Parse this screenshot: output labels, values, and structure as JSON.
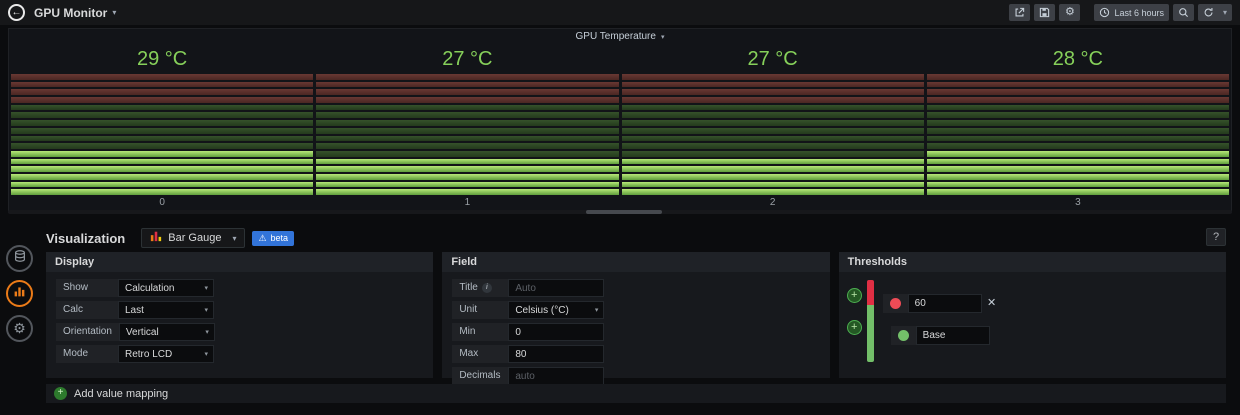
{
  "colors": {
    "value_green": "#86d05a",
    "lit_top": "#b7e878",
    "lit_bottom": "#5f9e3c",
    "threshold_red": "#e02f44",
    "threshold_green": "#73bf69",
    "accent_orange": "#eb7b18",
    "beta_blue": "#3274d9"
  },
  "topbar": {
    "title": "GPU Monitor",
    "time_range": "Last 6 hours"
  },
  "panel": {
    "title": "GPU Temperature",
    "gauges": [
      {
        "display": "29 °C",
        "label": "0"
      },
      {
        "display": "27 °C",
        "label": "1"
      },
      {
        "display": "27 °C",
        "label": "2"
      },
      {
        "display": "28 °C",
        "label": "3"
      }
    ]
  },
  "chart_data": {
    "type": "bar",
    "title": "GPU Temperature",
    "categories": [
      "0",
      "1",
      "2",
      "3"
    ],
    "values": [
      29,
      27,
      27,
      28
    ],
    "unit": "°C",
    "min": 0,
    "max": 80,
    "threshold": 60,
    "orientation": "vertical",
    "display_mode": "retro-lcd",
    "cell_rows": 16,
    "legend_position": "none",
    "grid": false
  },
  "editor": {
    "heading": "Visualization",
    "viz_picker": {
      "name": "Bar Gauge",
      "beta": "beta"
    },
    "help": "?",
    "display": {
      "title": "Display",
      "show_label": "Show",
      "show_value": "Calculation",
      "calc_label": "Calc",
      "calc_value": "Last",
      "orientation_label": "Orientation",
      "orientation_value": "Vertical",
      "mode_label": "Mode",
      "mode_value": "Retro LCD"
    },
    "field": {
      "title": "Field",
      "title_label": "Title",
      "title_placeholder": "Auto",
      "unit_label": "Unit",
      "unit_value": "Celsius (°C)",
      "min_label": "Min",
      "min_value": "0",
      "max_label": "Max",
      "max_value": "80",
      "decimals_label": "Decimals",
      "decimals_placeholder": "auto"
    },
    "thresholds": {
      "title": "Thresholds",
      "items": [
        {
          "value": "60"
        },
        {
          "value": "Base"
        }
      ]
    },
    "add_value_mapping": "Add value mapping"
  }
}
